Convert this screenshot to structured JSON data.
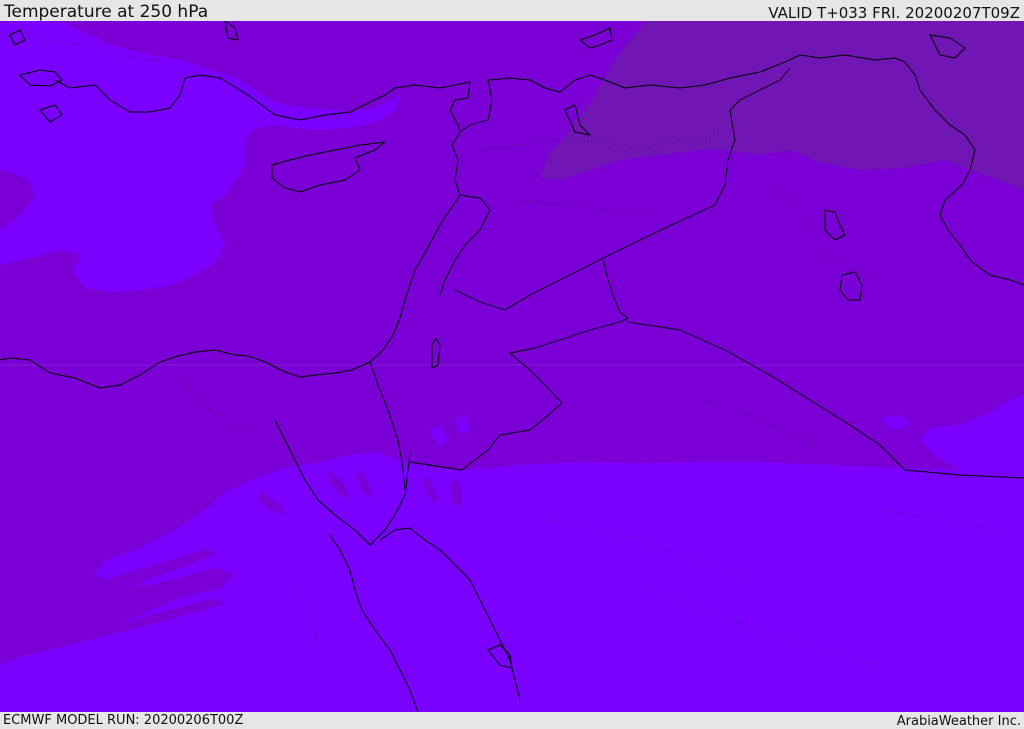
{
  "header": {
    "title": "Temperature at 250 hPa",
    "valid_time": "VALID T+033 FRI. 20200207T09Z"
  },
  "footer": {
    "model_run": "ECMWF MODEL RUN: 20200206T00Z",
    "credit": "ArabiaWeather Inc."
  },
  "map": {
    "region": "Eastern Mediterranean and Middle East",
    "colors": {
      "base_band": "#7a00d6",
      "light_band": "#7a00ff",
      "dark_band": "#7016b4",
      "coastline": "#000000"
    }
  }
}
